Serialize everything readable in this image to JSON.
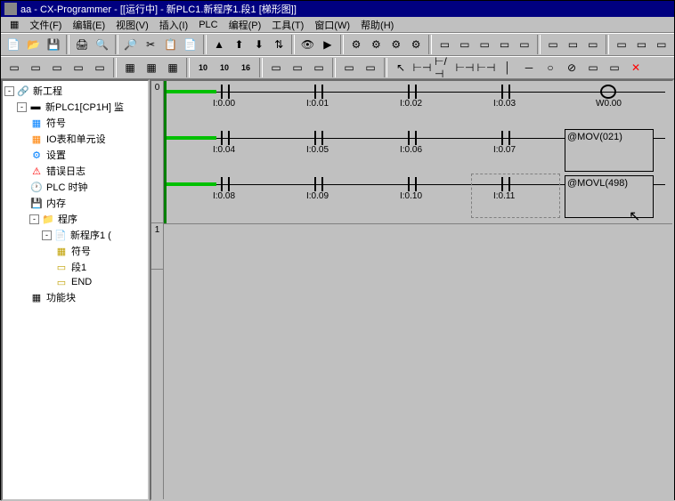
{
  "title": "aa - CX-Programmer - [[运行中] - 新PLC1.新程序1.段1 [梯形图]]",
  "menu": {
    "file": "文件(F)",
    "edit": "编辑(E)",
    "view": "视图(V)",
    "insert": "插入(I)",
    "plc": "PLC",
    "program": "编程(P)",
    "tools": "工具(T)",
    "window": "窗口(W)",
    "help": "帮助(H)"
  },
  "tree": {
    "root": "新工程",
    "plc": "新PLC1[CP1H] 监",
    "symbol": "符号",
    "iotable": "IO表和单元设",
    "settings": "设置",
    "errlog": "错误日志",
    "plcclock": "PLC 时钟",
    "memory": "内存",
    "programs": "程序",
    "program1": "新程序1 (",
    "psymbol": "符号",
    "section1": "段1",
    "end": "END",
    "funcblock": "功能块"
  },
  "ladder": {
    "rungs": [
      "0",
      "1"
    ],
    "row0": {
      "c0": "I:0.00",
      "c1": "I:0.01",
      "c2": "I:0.02",
      "c3": "I:0.03",
      "out": "W0.00"
    },
    "row1": {
      "c0": "I:0.04",
      "c1": "I:0.05",
      "c2": "I:0.06",
      "c3": "I:0.07",
      "box": "@MOV(021)"
    },
    "row2": {
      "c0": "I:0.08",
      "c1": "I:0.09",
      "c2": "I:0.10",
      "c3": "I:0.11",
      "box": "@MOVL(498)"
    }
  }
}
